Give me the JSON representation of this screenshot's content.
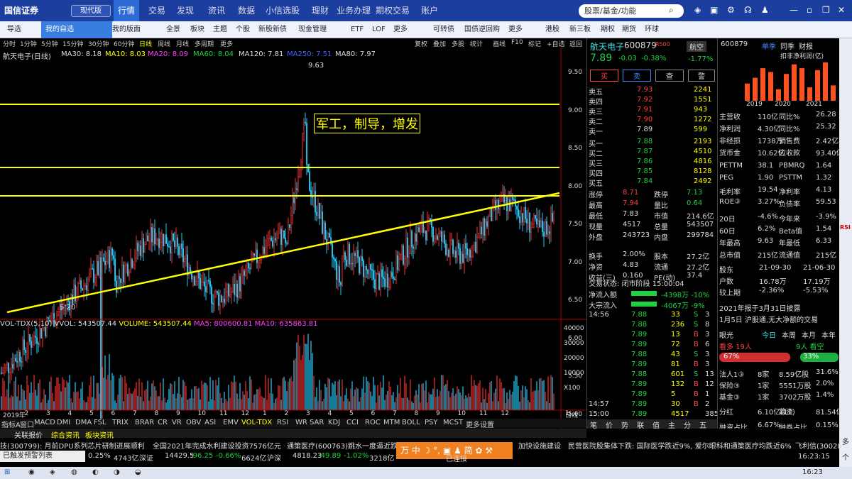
{
  "app": {
    "brand": "国信证券",
    "version": "现代版",
    "menu": [
      "行情",
      "交易",
      "发现",
      "资讯",
      "数据",
      "小信选股",
      "理财",
      "业务办理",
      "期权交易",
      "账户"
    ],
    "search_placeholder": "股票/基金/功能",
    "window_icons": [
      "minimize-icon",
      "maximize-icon",
      "close-icon"
    ]
  },
  "subnav": [
    "导选",
    "我的自选",
    "我的版面",
    "全景",
    "板块",
    "主题",
    "个股",
    "新股新债",
    "现金管理",
    "ETF",
    "LOF",
    "更多",
    "可转债",
    "国债逆回购",
    "更多",
    "港股",
    "新三板",
    "期权",
    "期货",
    "环球"
  ],
  "chart_tools": [
    "分时",
    "1分钟",
    "5分钟",
    "15分钟",
    "30分钟",
    "60分钟",
    "日线",
    "周线",
    "月线",
    "多周期",
    "更多"
  ],
  "chart_tools_right": [
    "复权",
    "叠加",
    "多股",
    "统计",
    "画线",
    "F10",
    "标记",
    "+自选",
    "返回"
  ],
  "ma_line": {
    "name": "航天电子(日线)",
    "ma30": "MA30: 8.18",
    "ma10": "MA10: 8.03",
    "ma20": "MA20: 8.09",
    "ma60": "MA60: 8.04",
    "ma120": "MA120: 7.81",
    "ma250": "MA250: 7.51",
    "ma80": "MA80: 7.97"
  },
  "annotation": "军工，制导，增发",
  "price_axis": [
    "9.50",
    "9.00",
    "8.50",
    "8.00",
    "7.50",
    "7.00",
    "6.50",
    "6.00",
    "5.50",
    "5.00"
  ],
  "marks": {
    "high": "9.63",
    "low": "5.20"
  },
  "vol_line": {
    "name": "VOL-TDX(5,10)",
    "vvol": "VVOL: 543507.44",
    "volume": "VOLUME: 543507.44",
    "ma5": "MA5: 800600.81",
    "ma10": "MA10: 635863.81"
  },
  "vol_axis": [
    "40000",
    "30000",
    "20000",
    "10000",
    "X100"
  ],
  "x_axis": [
    "2019年",
    "2",
    "3",
    "4",
    "5",
    "6",
    "7",
    "8",
    "9",
    "10",
    "11",
    "12",
    "1",
    "2",
    "3",
    "4",
    "5",
    "6",
    "7",
    "8",
    "9",
    "10",
    "11",
    "12",
    "1",
    "日线"
  ],
  "indicator_tabs": [
    "指标A",
    "窗口",
    "MACD",
    "DMI",
    "DMA",
    "FSL",
    "TRIX",
    "BRAR",
    "CR",
    "VR",
    "OBV",
    "ASI",
    "EMV",
    "VOL-TDX",
    "RSI",
    "WR",
    "SAR",
    "KDJ",
    "CCI",
    "ROC",
    "MTM",
    "BOLL",
    "PSY",
    "MCST",
    "更多",
    "设置"
  ],
  "bottom_tabs": [
    "关联报价",
    "综合资讯",
    "板块资讯"
  ],
  "stock": {
    "name": "航天电子",
    "code": "600879",
    "tag": "R500",
    "sector": "航空",
    "price": "7.89",
    "chg": "-0.03",
    "pct": "-0.38%",
    "sector_pct": "-1.77%",
    "buttons": [
      "买",
      "卖",
      "查",
      "警"
    ]
  },
  "asks": [
    [
      "卖五",
      "7.93",
      "2241"
    ],
    [
      "卖四",
      "7.92",
      "1551"
    ],
    [
      "卖三",
      "7.91",
      "943"
    ],
    [
      "卖二",
      "7.90",
      "1272"
    ],
    [
      "卖一",
      "7.89",
      "599"
    ]
  ],
  "bids": [
    [
      "买一",
      "7.88",
      "2193"
    ],
    [
      "买二",
      "7.87",
      "4510"
    ],
    [
      "买三",
      "7.86",
      "4816"
    ],
    [
      "买四",
      "7.85",
      "8128"
    ],
    [
      "买五",
      "7.84",
      "2492"
    ]
  ],
  "stats": [
    [
      "涨停",
      "8.71",
      "跌停",
      "7.13"
    ],
    [
      "最高",
      "7.94",
      "量比",
      "0.64"
    ],
    [
      "最低",
      "7.83",
      "市值",
      "214.6亿"
    ],
    [
      "现量",
      "4517",
      "总量",
      "543507"
    ],
    [
      "外盘",
      "243723",
      "内盘",
      "299784"
    ]
  ],
  "stats2": [
    [
      "换手",
      "2.00%",
      "股本",
      "27.2亿"
    ],
    [
      "净资",
      "4.83",
      "流通",
      "27.2亿"
    ],
    [
      "收益(三)",
      "0.160",
      "PE(动)",
      "37.4"
    ]
  ],
  "trade_status": "交易状态: 闭市阶段 15:00:04",
  "flows": [
    [
      "净流入额",
      "-4398万",
      "-10%"
    ],
    [
      "大宗流入",
      "-4067万",
      "-9%"
    ]
  ],
  "ticks": [
    [
      "14:56",
      "7.88",
      "33",
      "S",
      "3"
    ],
    [
      "",
      "7.88",
      "236",
      "S",
      "8"
    ],
    [
      "",
      "7.89",
      "13",
      "B",
      "3"
    ],
    [
      "",
      "7.89",
      "72",
      "B",
      "6"
    ],
    [
      "",
      "7.88",
      "43",
      "S",
      "3"
    ],
    [
      "",
      "7.89",
      "81",
      "B",
      "3"
    ],
    [
      "",
      "7.88",
      "601",
      "S",
      "13"
    ],
    [
      "",
      "7.89",
      "132",
      "B",
      "12"
    ],
    [
      "",
      "7.89",
      "5",
      "B",
      "1"
    ],
    [
      "14:57",
      "7.89",
      "30",
      "B",
      "2"
    ],
    [
      "15:00",
      "7.89",
      "4517",
      "",
      "385"
    ]
  ],
  "quote_tabs": [
    "笔",
    "价",
    "势",
    "联",
    "值",
    "主",
    "分",
    "五"
  ],
  "info": {
    "code": "600879",
    "tabs": [
      "单季",
      "同季",
      "财报"
    ],
    "chart_title": "扣非净利润(亿)",
    "years": [
      "2019",
      "2020",
      "2021"
    ],
    "profit": [
      0.45,
      0.6,
      0.85,
      0.75,
      0.3,
      0.7,
      0.95,
      0.85,
      0.35,
      0.8,
      1.0,
      0.4
    ],
    "fin": [
      [
        "主营收",
        "110亿",
        "同比%",
        "26.28"
      ],
      [
        "净利润",
        "4.30亿",
        "同比%",
        "25.32"
      ],
      [
        "非经损",
        "1738万",
        "销售费",
        "2.42亿"
      ],
      [
        "货币金",
        "10.62亿",
        "应收款",
        "93.40亿"
      ]
    ],
    "val": [
      [
        "PETTM",
        "38.1",
        "PBMRQ",
        "1.64"
      ],
      [
        "PEG",
        "1.90",
        "PSTTM",
        "1.32"
      ],
      [
        "毛利率",
        "19.54",
        "净利率",
        "4.13"
      ],
      [
        "ROE③",
        "3.27%",
        "负债率",
        "59.53"
      ]
    ],
    "perf": [
      [
        "20日",
        "-4.6%",
        "今年来",
        "-3.9%"
      ],
      [
        "60日",
        "6.2%",
        "Beta值",
        "1.54"
      ],
      [
        "年最高",
        "9.63",
        "年最低",
        "6.33"
      ],
      [
        "总市值",
        "215亿",
        "流通值",
        "215亿"
      ]
    ],
    "holders": [
      [
        "股东",
        "21-09-30",
        "21-06-30"
      ],
      [
        "户数",
        "16.78万",
        "17.19万"
      ],
      [
        "较上期",
        "-2.36%",
        "-5.53%"
      ]
    ],
    "news": [
      "2021年报于3月31日披露",
      "1月5日 沪股通,无大净额的交易"
    ],
    "view": {
      "label": "眼光",
      "tabs": [
        "今日",
        "本周",
        "本月",
        "本年"
      ],
      "bull": "看多",
      "bull_n": "19人",
      "bear_n": "9人",
      "bear": "看空",
      "bull_pct": "67%",
      "bear_pct": "33%"
    },
    "inst": [
      [
        "法人1③",
        "8家",
        "8.59亿股",
        "31.6%"
      ],
      [
        "保险③",
        "1家",
        "5551万股",
        "2.0%"
      ],
      [
        "基金③",
        "1家",
        "3702万股",
        "1.4%"
      ]
    ],
    "bonus": [
      "分红",
      "6.10亿(11)",
      "募资",
      "81.54亿(7)"
    ],
    "margin": [
      "融资占比",
      "6.67%",
      "融券占比",
      "0.15%"
    ]
  },
  "news_ticker": [
    "技(300799): 月前DPU系列芯片研制进展顺利",
    "全国2021年完成水利建设投资7576亿元",
    "通策医疗(600763)跳水一度逼近跌停",
    "加快设施建设",
    "民营医院股集体下跌: 国际医学跌近9%, 爱尔眼科和通策医疗均跌近6%",
    "飞利信(30028"
  ],
  "index_ticker": [
    "0.25%",
    "4743亿",
    "深证",
    "14429.5",
    "-96.25",
    "-0.66%",
    "6624亿",
    "沪深",
    "4818.23",
    "-49.89",
    "-1.02%",
    "3218亿"
  ],
  "ticker_left": "已触发预警列表",
  "taskbar_time": "16:23",
  "taskbar_time2": "16:23:15",
  "conn": "已连接",
  "rstrip_labels": [
    "RSI",
    "多",
    "个"
  ]
}
